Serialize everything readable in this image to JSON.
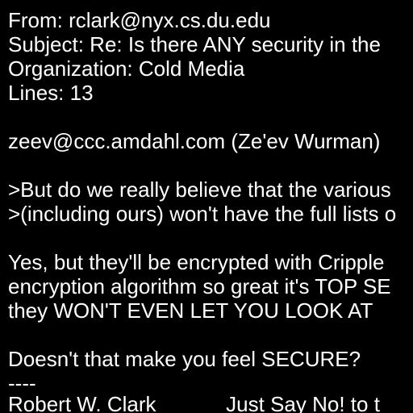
{
  "colors": {
    "background": "#000000",
    "text": "#ffffff"
  },
  "message": {
    "header": {
      "from": "From: rclark@nyx.cs.du.edu",
      "subject": "Subject: Re: Is there ANY security in the",
      "organization": "Organization: Cold Media",
      "lines": "Lines: 13"
    },
    "attribution": "zeev@ccc.amdahl.com (Ze'ev Wurman)",
    "quoted": [
      ">But do we really believe that the various",
      ">(including ours) won't have the full lists o"
    ],
    "body": [
      "Yes, but they'll be encrypted with Cripple",
      "encryption algorithm so great it's TOP SE",
      "they WON'T EVEN LET YOU LOOK AT"
    ],
    "closing": "Doesn't that make you feel SECURE?",
    "separator": "----",
    "signature": "Robert W. Clark            Just Say No! to t"
  }
}
